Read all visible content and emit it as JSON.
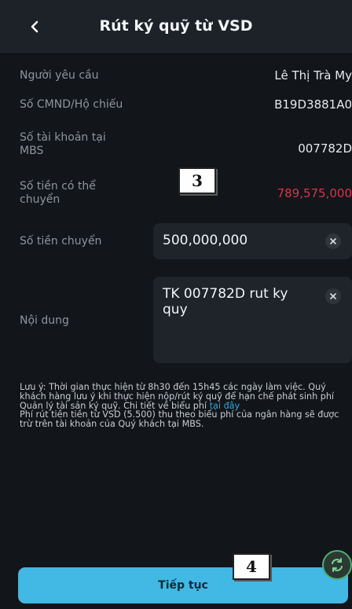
{
  "header": {
    "title": "Rút ký quỹ từ VSD"
  },
  "fields": {
    "requester_label": "Người yêu cầu",
    "requester_value": "Lê Thị Trà My",
    "id_label": "Số CMND/Hộ chiếu",
    "id_value": "B19D3881A0",
    "account_label": "Số tài khoản tại MBS",
    "account_value": "007782D",
    "available_label": "Số tiền có thể chuyển",
    "available_value": "789,575,000",
    "transfer_label": "Số tiền chuyển",
    "transfer_value": "500,000,000",
    "content_label": "Nội dung",
    "content_value": "TK 007782D rut ky quy"
  },
  "note": {
    "text1": "Lưu ý: Thời gian thực hiện từ 8h30 đến 15h45 các ngày làm việc. Quý khách hàng lưu ý khi thực hiện nộp/rút ký quỹ để hạn chế phát sinh phí Quản lý tài sản ký quỹ. Chi tiết về biểu phí ",
    "link": "tại đây",
    "text2": "Phí rút tiền tiền từ VSD (5.500) thu theo biểu phí của ngân hàng sẽ được trừ trên tài khoản của Quý khách tại MBS."
  },
  "continue_label": "Tiếp tục",
  "annotations": {
    "badge_3": "3",
    "badge_4": "4"
  },
  "colors": {
    "accent": "#42b8e4",
    "amount_red": "#d7364c",
    "background": "#121519"
  },
  "icons": {
    "back": "chevron-left-icon",
    "clear": "close-icon",
    "fab": "transfer-icon"
  }
}
